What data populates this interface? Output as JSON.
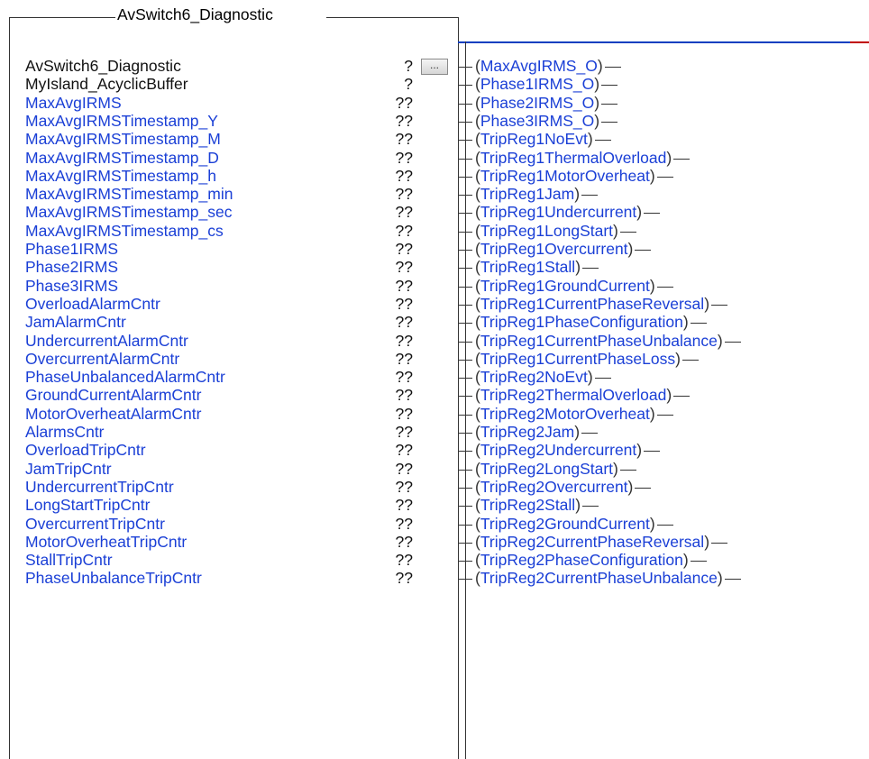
{
  "block": {
    "title": "AvSwitch6_Diagnostic"
  },
  "params": [
    {
      "name": "AvSwitch6_Diagnostic",
      "value": "?"
    },
    {
      "name": "MyIsland_AcyclicBuffer",
      "value": "?"
    },
    {
      "name": "MaxAvgIRMS",
      "value": "??"
    },
    {
      "name": "MaxAvgIRMSTimestamp_Y",
      "value": "??"
    },
    {
      "name": "MaxAvgIRMSTimestamp_M",
      "value": "??"
    },
    {
      "name": "MaxAvgIRMSTimestamp_D",
      "value": "??"
    },
    {
      "name": "MaxAvgIRMSTimestamp_h",
      "value": "??"
    },
    {
      "name": "MaxAvgIRMSTimestamp_min",
      "value": "??"
    },
    {
      "name": "MaxAvgIRMSTimestamp_sec",
      "value": "??"
    },
    {
      "name": "MaxAvgIRMSTimestamp_cs",
      "value": "??"
    },
    {
      "name": "Phase1IRMS",
      "value": "??"
    },
    {
      "name": "Phase2IRMS",
      "value": "??"
    },
    {
      "name": "Phase3IRMS",
      "value": "??"
    },
    {
      "name": "OverloadAlarmCntr",
      "value": "??"
    },
    {
      "name": "JamAlarmCntr",
      "value": "??"
    },
    {
      "name": "UndercurrentAlarmCntr",
      "value": "??"
    },
    {
      "name": "OvercurrentAlarmCntr",
      "value": "??"
    },
    {
      "name": "PhaseUnbalancedAlarmCntr",
      "value": "??"
    },
    {
      "name": "GroundCurrentAlarmCntr",
      "value": "??"
    },
    {
      "name": "MotorOverheatAlarmCntr",
      "value": "??"
    },
    {
      "name": "AlarmsCntr",
      "value": "??"
    },
    {
      "name": "OverloadTripCntr",
      "value": "??"
    },
    {
      "name": "JamTripCntr",
      "value": "??"
    },
    {
      "name": "UndercurrentTripCntr",
      "value": "??"
    },
    {
      "name": "LongStartTripCntr",
      "value": "??"
    },
    {
      "name": "OvercurrentTripCntr",
      "value": "??"
    },
    {
      "name": "MotorOverheatTripCntr",
      "value": "??"
    },
    {
      "name": "StallTripCntr",
      "value": "??"
    },
    {
      "name": "PhaseUnbalanceTripCntr",
      "value": "??"
    }
  ],
  "ellipsis_label": "...",
  "coils": [
    "MaxAvgIRMS_O",
    "Phase1IRMS_O",
    "Phase2IRMS_O",
    "Phase3IRMS_O",
    "TripReg1NoEvt",
    "TripReg1ThermalOverload",
    "TripReg1MotorOverheat",
    "TripReg1Jam",
    "TripReg1Undercurrent",
    "TripReg1LongStart",
    "TripReg1Overcurrent",
    "TripReg1Stall",
    "TripReg1GroundCurrent",
    "TripReg1CurrentPhaseReversal",
    "TripReg1PhaseConfiguration",
    "TripReg1CurrentPhaseUnbalance",
    "TripReg1CurrentPhaseLoss",
    "TripReg2NoEvt",
    "TripReg2ThermalOverload",
    "TripReg2MotorOverheat",
    "TripReg2Jam",
    "TripReg2Undercurrent",
    "TripReg2LongStart",
    "TripReg2Overcurrent",
    "TripReg2Stall",
    "TripReg2GroundCurrent",
    "TripReg2CurrentPhaseReversal",
    "TripReg2PhaseConfiguration",
    "TripReg2CurrentPhaseUnbalance"
  ],
  "colors": {
    "param_text": "#1a3fd6",
    "coil_text": "#1a3fd6",
    "frame": "#333333",
    "rung_red": "#c00000"
  }
}
